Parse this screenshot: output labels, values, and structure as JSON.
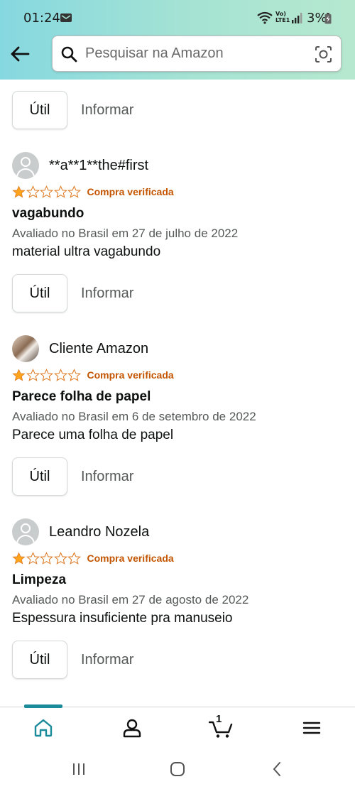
{
  "status_bar": {
    "time": "01:24",
    "volte_top": "Vo)",
    "volte_bottom": "LTE1",
    "battery": "3%"
  },
  "search": {
    "placeholder": "Pesquisar na Amazon"
  },
  "actions": {
    "helpful": "Útil",
    "report": "Informar"
  },
  "reviews": [
    {
      "reviewer": "**a**1**the#first",
      "stars": 1,
      "verified": "Compra verificada",
      "title": "vagabundo",
      "date": "Avaliado no Brasil em 27 de julho de 2022",
      "body": "material ultra vagabundo"
    },
    {
      "reviewer": "Cliente Amazon",
      "stars": 1,
      "verified": "Compra verificada",
      "title": "Parece folha de papel",
      "date": "Avaliado no Brasil em 6 de setembro de 2022",
      "body": "Parece uma folha de papel"
    },
    {
      "reviewer": "Leandro Nozela",
      "stars": 1,
      "verified": "Compra verificada",
      "title": "Limpeza",
      "date": "Avaliado no Brasil em 27 de agosto de 2022",
      "body": "Espessura insuficiente pra manuseio"
    }
  ],
  "bottom_nav": {
    "cart_count": "1"
  },
  "colors": {
    "accent": "#1b8a9b",
    "star": "#ffa41c",
    "verified": "#c45500"
  }
}
